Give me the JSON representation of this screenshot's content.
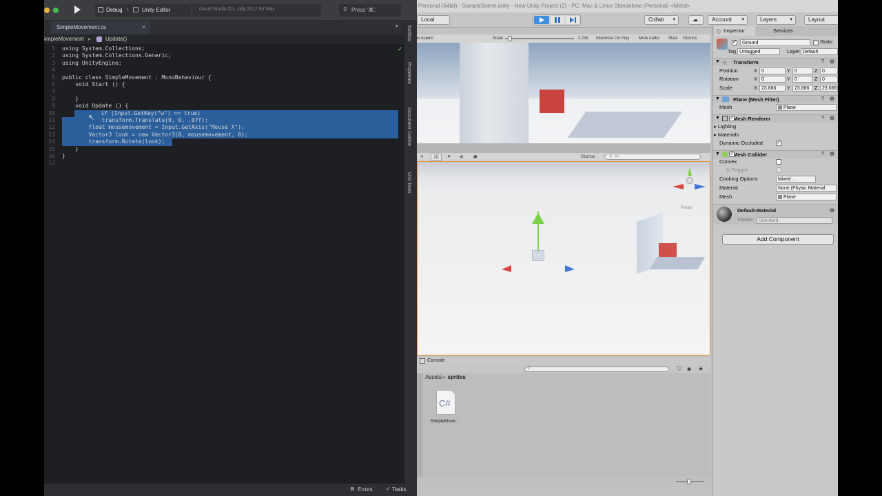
{
  "vs": {
    "config": "Debug",
    "target": "Unity Editor",
    "status_title": "Visual Studio Co...nity 2017 for Mac",
    "search_placeholder": "Press '⌘.'",
    "tab": "SimpleMovement.cs",
    "crumb_class": "SimpleMovement",
    "crumb_method": "Update()",
    "code": [
      {
        "n": "1",
        "t": "using System.Collections;"
      },
      {
        "n": "2",
        "t": "using System.Collections.Generic;"
      },
      {
        "n": "3",
        "t": "using UnityEngine;"
      },
      {
        "n": "4",
        "t": ""
      },
      {
        "n": "5",
        "t": "public class SimpleMovement : MonoBehaviour {"
      },
      {
        "n": "6",
        "t": "    void Start () {"
      },
      {
        "n": "7",
        "t": ""
      },
      {
        "n": "8",
        "t": "    }"
      },
      {
        "n": "9",
        "t": "    void Update () {"
      },
      {
        "n": "10",
        "t": "        if (Input.GetKey(\"w\") == true)"
      },
      {
        "n": "11",
        "t": "            transform.Translate(0, 0, .07f);"
      },
      {
        "n": "12",
        "t": "        float mousemovement = Input.GetAxis(\"Mouse X\");"
      },
      {
        "n": "13",
        "t": "        Vector3 look = new Vector3(0, mousemovement, 0);"
      },
      {
        "n": "14",
        "t": "        transform.Rotate(look);"
      },
      {
        "n": "15",
        "t": "    }"
      },
      {
        "n": "16",
        "t": "}"
      },
      {
        "n": "17",
        "t": ""
      }
    ],
    "side_tabs": [
      "Toolbox",
      "Properties",
      "Document Outline",
      "Unit Tests"
    ],
    "status_errors": "Errors",
    "status_tasks": "Tasks"
  },
  "unity": {
    "title": "Personal (64bit) - SampleScene.unity - New Unity Project (2) - PC, Mac & Linux Standalone (Personal) <Metal>",
    "local_label": "Local",
    "collab_label": "Collab",
    "account_label": "Account",
    "layers_label": "Layers",
    "layout_label": "Layout",
    "game_bar": {
      "aspect": "Free Aspect",
      "scale_label": "Scale",
      "scale_value": "2.23x",
      "maximize": "Maximize On Play",
      "mute": "Mute Audio",
      "stats": "Stats",
      "gizmos": "Gizmos"
    },
    "scene_bar": {
      "mode": "2D",
      "gizmos": "Gizmos",
      "search": "All",
      "persp": "Persp"
    },
    "console": "Console",
    "project": {
      "crumb_root": "Assets",
      "crumb_folder": "sprites",
      "asset_name": "SimpleMove...",
      "asset_icon": "C#"
    },
    "inspector": {
      "tabs": [
        "Inspector",
        "Services"
      ],
      "object_name": "Ground",
      "static_label": "Static",
      "tag_label": "Tag",
      "tag_value": "Untagged",
      "layer_label": "Layer",
      "layer_value": "Default",
      "transform": {
        "title": "Transform",
        "position_label": "Position",
        "rotation_label": "Rotation",
        "scale_label": "Scale",
        "position": [
          "0",
          "0",
          "0"
        ],
        "rotation": [
          "0",
          "0",
          "0"
        ],
        "scale": [
          "23.666",
          "23.666",
          "23.666"
        ]
      },
      "mesh_filter": {
        "title": "Plane (Mesh Filter)",
        "mesh_label": "Mesh",
        "mesh_value": "Plane"
      },
      "mesh_renderer": {
        "title": "Mesh Renderer",
        "lighting": "Lighting",
        "materials": "Materials",
        "dynamic_occluded": "Dynamic Occluded"
      },
      "mesh_collider": {
        "title": "Mesh Collider",
        "convex": "Convex",
        "is_trigger": "Is Trigger",
        "cooking": "Cooking Options",
        "cooking_value": "Mixed ...",
        "material_label": "Material",
        "material_value": "None (Physic Material",
        "mesh_label": "Mesh",
        "mesh_value": "Plane"
      },
      "default_material": {
        "name": "Default-Material",
        "shader_label": "Shader",
        "shader_value": "Standard"
      },
      "add_component": "Add Component"
    }
  }
}
